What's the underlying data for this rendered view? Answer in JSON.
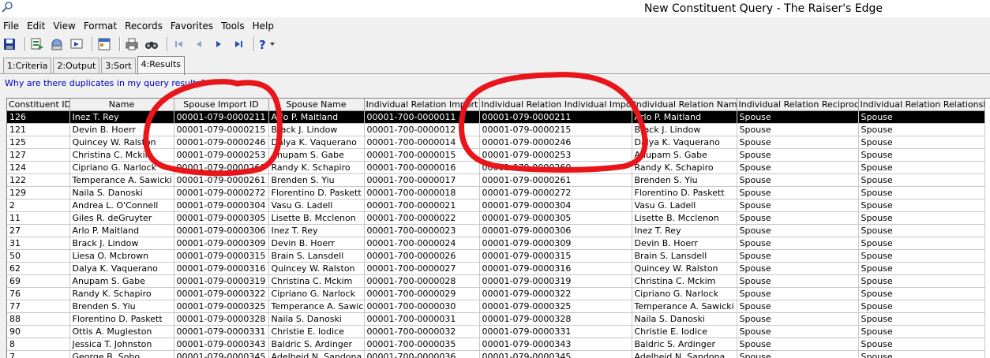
{
  "window": {
    "title": "New Constituent Query - The Raiser's Edge"
  },
  "menu": [
    "File",
    "Edit",
    "View",
    "Format",
    "Records",
    "Favorites",
    "Tools",
    "Help"
  ],
  "toolbar": {
    "icons": [
      "save-icon",
      "save-close-icon",
      "export-icon",
      "import-icon",
      "properties-icon",
      "print-icon",
      "find-icon",
      "first-record-icon",
      "previous-record-icon",
      "next-record-icon",
      "last-record-icon",
      "help-icon",
      "dropdown-arrow-icon"
    ],
    "colors": {
      "save": "#1c3f95",
      "nav": "#1f4fb5",
      "help": "#1a3db8"
    }
  },
  "tabs": [
    {
      "label": "1:Criteria",
      "active": false
    },
    {
      "label": "2:Output",
      "active": false
    },
    {
      "label": "3:Sort",
      "active": false
    },
    {
      "label": "4:Results",
      "active": true
    }
  ],
  "help_link": "Why are there duplicates in my query results?",
  "annotation_color": "#e8151b",
  "grid": {
    "columns": [
      "Constituent ID",
      "Name",
      "Spouse Import ID",
      "Spouse Name",
      "Individual Relation Import ID",
      "Individual Relation Individual Import ID",
      "Individual Relation Name",
      "Individual Relation Reciprocal",
      "Individual Relation Relationship"
    ],
    "rows": [
      [
        "126",
        "Inez T. Rey",
        "00001-079-0000211",
        "Arlo P. Maitland",
        "00001-700-0000011",
        "00001-079-0000211",
        "Arlo P. Maitland",
        "Spouse",
        "Spouse"
      ],
      [
        "121",
        "Devin B. Hoerr",
        "00001-079-0000215",
        "Brack J. Lindow",
        "00001-700-0000012",
        "00001-079-0000215",
        "Brack J. Lindow",
        "Spouse",
        "Spouse"
      ],
      [
        "125",
        "Quincey W. Ralston",
        "00001-079-0000246",
        "Dalya K. Vaquerano",
        "00001-700-0000014",
        "00001-079-0000246",
        "Dalya K. Vaquerano",
        "Spouse",
        "Spouse"
      ],
      [
        "127",
        "Christina C. Mckim",
        "00001-079-0000253",
        "Anupam S. Gabe",
        "00001-700-0000015",
        "00001-079-0000253",
        "Anupam S. Gabe",
        "Spouse",
        "Spouse"
      ],
      [
        "124",
        "Cipriano G. Narlock",
        "00001-079-0000260",
        "Randy K. Schapiro",
        "00001-700-0000016",
        "00001-079-0000260",
        "Randy K. Schapiro",
        "Spouse",
        "Spouse"
      ],
      [
        "122",
        "Temperance A. Sawicki",
        "00001-079-0000261",
        "Brenden S. Yiu",
        "00001-700-0000017",
        "00001-079-0000261",
        "Brenden S. Yiu",
        "Spouse",
        "Spouse"
      ],
      [
        "129",
        "Naila S. Danoski",
        "00001-079-0000272",
        "Florentino D. Paskett",
        "00001-700-0000018",
        "00001-079-0000272",
        "Florentino D. Paskett",
        "Spouse",
        "Spouse"
      ],
      [
        "2",
        "Andrea L. O'Connell",
        "00001-079-0000304",
        "Vasu G. Ladell",
        "00001-700-0000021",
        "00001-079-0000304",
        "Vasu G. Ladell",
        "Spouse",
        "Spouse"
      ],
      [
        "11",
        "Giles R. deGruyter",
        "00001-079-0000305",
        "Lisette B. Mcclenon",
        "00001-700-0000022",
        "00001-079-0000305",
        "Lisette B. Mcclenon",
        "Spouse",
        "Spouse"
      ],
      [
        "27",
        "Arlo P. Maitland",
        "00001-079-0000306",
        "Inez T. Rey",
        "00001-700-0000023",
        "00001-079-0000306",
        "Inez T. Rey",
        "Spouse",
        "Spouse"
      ],
      [
        "31",
        "Brack J. Lindow",
        "00001-079-0000309",
        "Devin B. Hoerr",
        "00001-700-0000024",
        "00001-079-0000309",
        "Devin B. Hoerr",
        "Spouse",
        "Spouse"
      ],
      [
        "50",
        "Liesa O. Mcbrown",
        "00001-079-0000315",
        "Brain S. Lansdell",
        "00001-700-0000026",
        "00001-079-0000315",
        "Brain S. Lansdell",
        "Spouse",
        "Spouse"
      ],
      [
        "62",
        "Dalya K. Vaquerano",
        "00001-079-0000316",
        "Quincey W. Ralston",
        "00001-700-0000027",
        "00001-079-0000316",
        "Quincey W. Ralston",
        "Spouse",
        "Spouse"
      ],
      [
        "69",
        "Anupam S. Gabe",
        "00001-079-0000319",
        "Christina C. Mckim",
        "00001-700-0000028",
        "00001-079-0000319",
        "Christina C. Mckim",
        "Spouse",
        "Spouse"
      ],
      [
        "76",
        "Randy K. Schapiro",
        "00001-079-0000322",
        "Cipriano G. Narlock",
        "00001-700-0000029",
        "00001-079-0000322",
        "Cipriano G. Narlock",
        "Spouse",
        "Spouse"
      ],
      [
        "77",
        "Brenden S. Yiu",
        "00001-079-0000325",
        "Temperance A. Sawicki",
        "00001-700-0000030",
        "00001-079-0000325",
        "Temperance A. Sawicki",
        "Spouse",
        "Spouse"
      ],
      [
        "88",
        "Florentino D. Paskett",
        "00001-079-0000328",
        "Naila S. Danoski",
        "00001-700-0000031",
        "00001-079-0000328",
        "Naila S. Danoski",
        "Spouse",
        "Spouse"
      ],
      [
        "90",
        "Ottis A. Mugleston",
        "00001-079-0000331",
        "Christie E. Iodice",
        "00001-700-0000032",
        "00001-079-0000331",
        "Christie E. Iodice",
        "Spouse",
        "Spouse"
      ],
      [
        "8",
        "Jessica T. Johnston",
        "00001-079-0000343",
        "Baldric S. Ardinger",
        "00001-700-0000035",
        "00001-079-0000343",
        "Baldric S. Ardinger",
        "Spouse",
        "Spouse"
      ],
      [
        "7",
        "George B. Soho",
        "00001-079-0000345",
        "Adelheid N. Sandona",
        "00001-700-0000036",
        "00001-079-0000345",
        "Adelheid N. Sandona",
        "Spouse",
        "Spouse"
      ]
    ]
  }
}
